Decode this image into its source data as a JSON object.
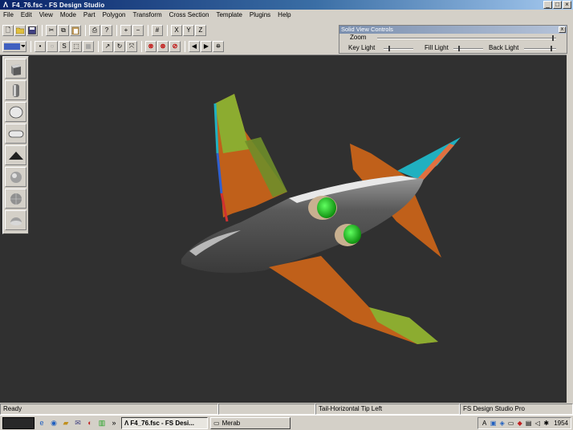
{
  "window": {
    "title": "F4_76.fsc - FS Design Studio"
  },
  "menu": [
    "File",
    "Edit",
    "View",
    "Mode",
    "Part",
    "Polygon",
    "Transform",
    "Cross Section",
    "Template",
    "Plugins",
    "Help"
  ],
  "toolbar1": {
    "zoom_in_glyph": "+",
    "zoom_out_glyph": "−",
    "grid_glyph": "#",
    "x_glyph": "X",
    "y_glyph": "Y",
    "z_glyph": "Z"
  },
  "solid_view_controls": {
    "title": "Solid View Controls",
    "close_glyph": "x",
    "zoom_label": "Zoom",
    "zoom_value": 0.98,
    "key_light_label": "Key Light",
    "key_light_value": 0.2,
    "fill_light_label": "Fill Light",
    "fill_light_value": 0.2,
    "back_light_label": "Back Light",
    "back_light_value": 0.85
  },
  "status": {
    "ready": "Ready",
    "part": "Tail-Horizontal Tip Left",
    "product": "FS Design Studio Pro"
  },
  "taskbar": {
    "active_task": "F4_76.fsc - FS Desi...",
    "inactive_task": "Merab",
    "more_glyph": "»",
    "tray_lang": "A",
    "clock": "1954"
  },
  "colors": {
    "model_orange": "#c0601a",
    "model_green": "#8cac30",
    "model_cyan": "#20b0c0",
    "model_red": "#d03030",
    "model_blue": "#3060d0",
    "fuselage": "#4a4a4a",
    "engine_green": "#30d030",
    "viewport_bg": "#303030"
  }
}
